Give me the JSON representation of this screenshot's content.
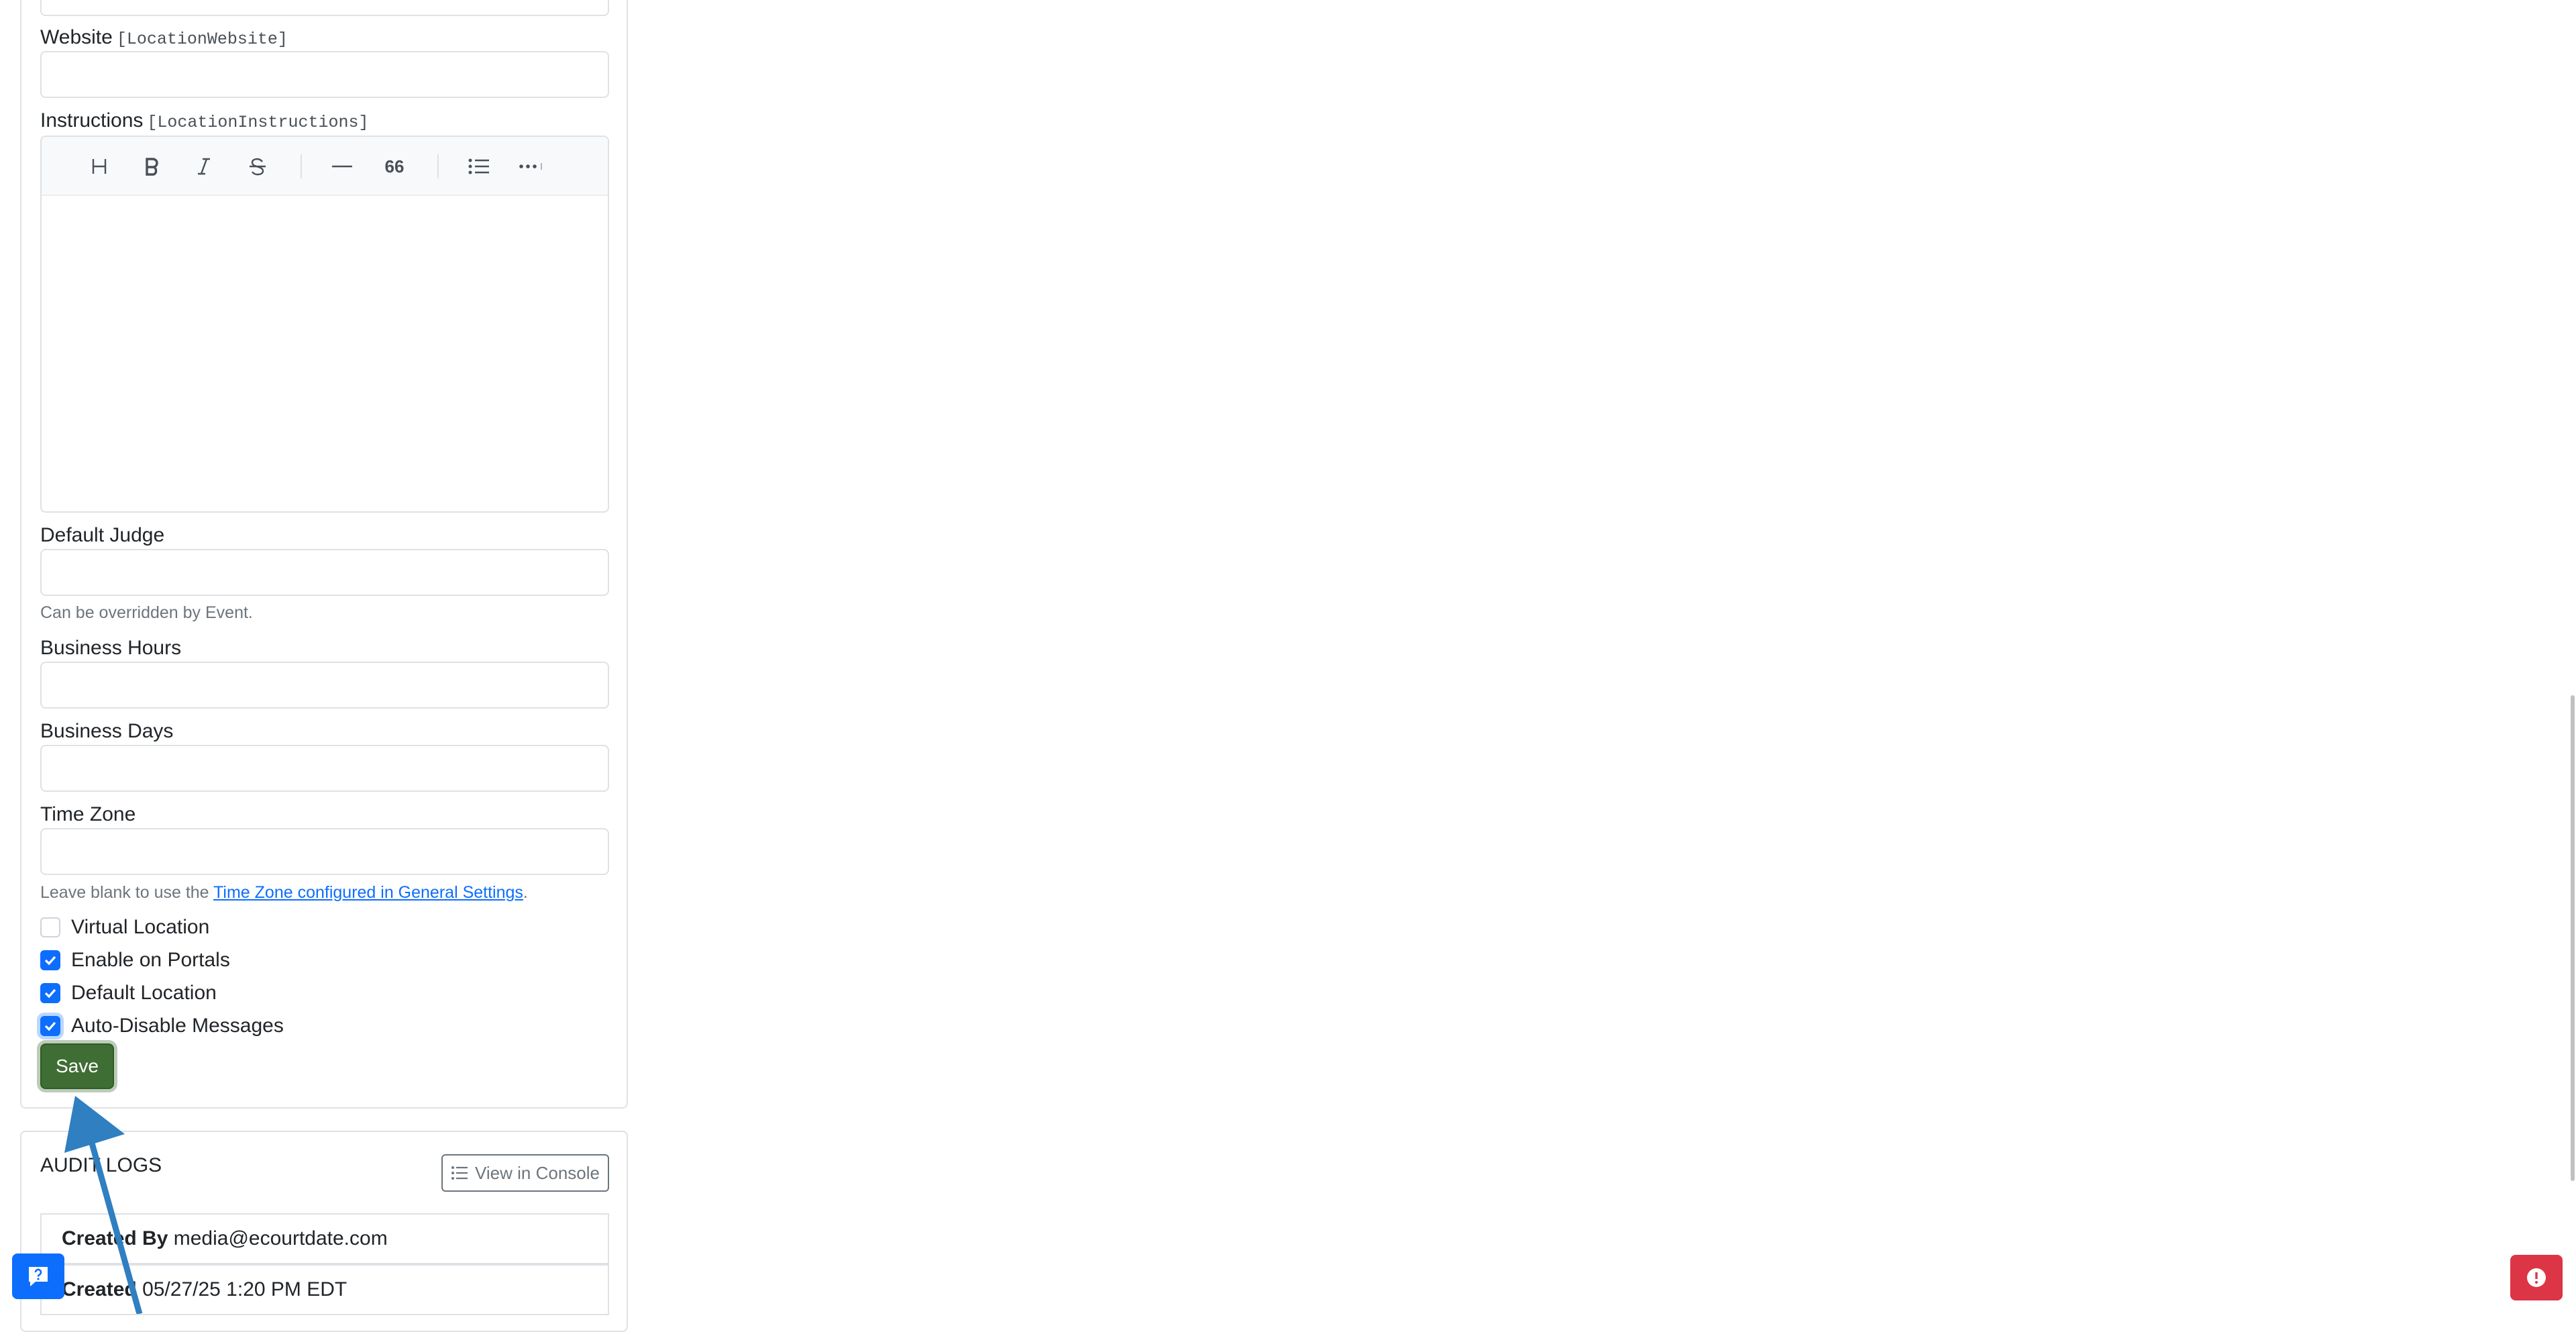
{
  "form": {
    "website_label": "Website",
    "website_token": "[LocationWebsite]",
    "website_value": "",
    "instructions_label": "Instructions",
    "instructions_token": "[LocationInstructions]",
    "instructions_value": "",
    "toolbar": {
      "heading_glyph": "H",
      "bold_glyph": "B",
      "italic_glyph": "I",
      "strike_glyph": "S",
      "quote_glyph": "66"
    },
    "default_judge_label": "Default Judge",
    "default_judge_value": "",
    "default_judge_help": "Can be overridden by Event.",
    "business_hours_label": "Business Hours",
    "business_hours_value": "",
    "business_days_label": "Business Days",
    "business_days_value": "",
    "time_zone_label": "Time Zone",
    "time_zone_value": "",
    "time_zone_help_prefix": "Leave blank to use the ",
    "time_zone_help_link": "Time Zone configured in General Settings",
    "time_zone_help_suffix": ".",
    "checkboxes": [
      {
        "label": "Virtual Location",
        "checked": false
      },
      {
        "label": "Enable on Portals",
        "checked": true
      },
      {
        "label": "Default Location",
        "checked": true
      },
      {
        "label": "Auto-Disable Messages",
        "checked": true
      }
    ],
    "save_label": "Save"
  },
  "audit": {
    "title": "AUDIT LOGS",
    "view_console_label": "View in Console",
    "rows": [
      {
        "key": "Created By",
        "value": "media@ecourtdate.com"
      },
      {
        "key": "Created",
        "value": "05/27/25 1:20 PM EDT"
      }
    ]
  },
  "colors": {
    "primary": "#0d6efd",
    "save": "#3f6e34",
    "alert": "#dc3545",
    "annotation_arrow": "#2f7fc1"
  },
  "icons": {
    "help_fab": "help-chat-icon",
    "alert_fab": "alert-icon",
    "console": "list-icon"
  }
}
